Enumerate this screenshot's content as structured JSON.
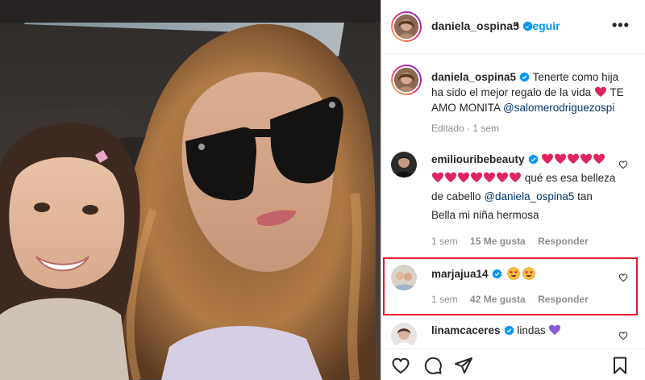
{
  "post": {
    "author": "daniela_ospina5",
    "follow_label": "Seguir",
    "separator": "•",
    "more_label": "•••",
    "caption_text": "Tenerte como hija ha sido el mejor regalo de la vida",
    "caption_emoji": "heart",
    "caption_tail": "TE AMO MONITA",
    "caption_mention": "@salomerodriguezospi",
    "caption_meta": "Editado · 1 sem"
  },
  "comments": [
    {
      "user": "emiliouribebeauty",
      "verified": true,
      "hearts_line1": 5,
      "hearts_line2": 7,
      "text": "qué es esa belleza de cabello",
      "mention": "@daniela_ospina5",
      "text_tail": "tan Bella mi niña hermosa",
      "time": "1 sem",
      "likes": "15 Me gusta",
      "reply": "Responder"
    },
    {
      "user": "marjajua14",
      "verified": true,
      "emoji_count": 2,
      "time": "1 sem",
      "likes": "42 Me gusta",
      "reply": "Responder"
    },
    {
      "user": "linamcaceres",
      "verified": true,
      "text": "lindas",
      "emoji": "purple-heart"
    }
  ],
  "icons": {
    "like": "heart-outline-icon",
    "comment": "comment-bubble-icon",
    "share": "paper-plane-icon",
    "save": "bookmark-icon",
    "verified": "verified-badge-icon"
  },
  "colors": {
    "link_blue": "#0095f6",
    "verified_blue": "#0095f6",
    "mention": "#00376b",
    "heart_red": "#e0245e",
    "highlight_red": "#e3182d",
    "muted": "#8e8e8e"
  }
}
